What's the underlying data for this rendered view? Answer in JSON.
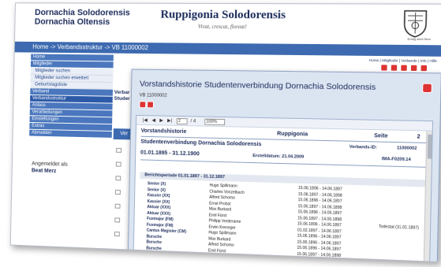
{
  "header": {
    "org_line1": "Dornachia Solodorensis",
    "org_line2": "Dornachia Oltensis",
    "brand": "Ruppigonia Solodorensis",
    "motto": "Vivat, crescat, floreat!",
    "crest_caption": "Erwig sind Herz"
  },
  "nav": {
    "breadcrumb": "Home -> Verbandsstruktur -> VB 11000002",
    "top_links": "Home | Mitglieder | Verbande | Info | Hilfe"
  },
  "sidebar": {
    "items": [
      {
        "label": "Home"
      },
      {
        "label": "Mitglieder"
      },
      {
        "label": "Mitglieder suchen"
      },
      {
        "label": "Mitglieder suchen erweitert"
      },
      {
        "label": "Geburtstagsliste"
      },
      {
        "label": "Verband"
      },
      {
        "label": "Verbandsstruktur"
      },
      {
        "label": "Anlass"
      },
      {
        "label": "Verarbeitungen"
      },
      {
        "label": "Einstellungen"
      },
      {
        "label": "Extras"
      },
      {
        "label": "Abmelden"
      }
    ],
    "login_label": "Angemeldet als",
    "login_user": "Beat Merz"
  },
  "background": {
    "org_line1": "Verbar",
    "org_line2": "Studer",
    "button": "Ver"
  },
  "modal": {
    "title": "Vorstandshistorie Studentenverbindung Dornachia Solodorensis",
    "id": "VB 11000002",
    "toolbar": {
      "nav_first": "|◀",
      "nav_prev": "◀",
      "nav_next": "▶",
      "nav_last": "▶|",
      "page_value": "2",
      "page_total": "/ 4",
      "zoom": "100%"
    },
    "doc": {
      "heading": "Vorstandshistorie",
      "org_name": "Ruppigonia",
      "page_label": "Seite",
      "page_value": "2",
      "verbindung": "Studentenverbindung Dornachia Solodorensis",
      "verband_label": "Verbands-ID:",
      "verband_id": "11000002",
      "date_range": "01.01.1895 - 31.12.1900",
      "created_label": "Erstelldatum: 21.04.2009",
      "form_id": "IMA-F0209.14",
      "period": "Berichtsperiode 01.01.1897 - 31.12.1897",
      "rows": [
        {
          "role": "Senior (X)",
          "name": "Hugo Spillmann",
          "dates": "15.06.1896 - 14.06.1897",
          "note": ""
        },
        {
          "role": "Senior (X)",
          "name": "Charles Vonzelbach",
          "dates": "15.06.1897 - 14.06.1898",
          "note": ""
        },
        {
          "role": "Kassier (XX)",
          "name": "Alfred Schomo",
          "dates": "15.06.1896 - 14.06.1897",
          "note": ""
        },
        {
          "role": "Kassier (XX)",
          "name": "Ernst Probst",
          "dates": "15.06.1897 - 14.06.1898",
          "note": ""
        },
        {
          "role": "Aktuar (XXX)",
          "name": "Max Burkard",
          "dates": "15.06.1896 - 14.06.1897",
          "note": ""
        },
        {
          "role": "Aktuar (XXX)",
          "name": "Emil Fürst",
          "dates": "15.06.1897 - 14.06.1898",
          "note": ""
        },
        {
          "role": "Fuxmajor (FM)",
          "name": "Philipp Verderame",
          "dates": "15.06.1896 - 14.06.1897",
          "note": "Todestat (31.01.1897)"
        },
        {
          "role": "Fuxmajor (FM)",
          "name": "Erwin Kreneger",
          "dates": "01.02.1897 - 14.06.1897",
          "note": ""
        },
        {
          "role": "Cantus Magister (CM)",
          "name": "Hugo Spillmann",
          "dates": "15.06.1896 - 14.06.1897",
          "note": ""
        },
        {
          "role": "Bursche",
          "name": "Max Burkard",
          "dates": "15.06.1896 - 14.06.1897",
          "note": ""
        },
        {
          "role": "Bursche",
          "name": "Alfred Schomo",
          "dates": "15.06.1896 - 14.06.1897",
          "note": ""
        },
        {
          "role": "Bursche",
          "name": "Emil Fürst",
          "dates": "15.06.1897 - 14.06.1898",
          "note": ""
        }
      ]
    }
  },
  "colors": {
    "nav_blue": "#3d6ab0",
    "dark_navy": "#1c2c5c",
    "action_red": "#d33333",
    "modal_bg": "#dbe4f1"
  }
}
